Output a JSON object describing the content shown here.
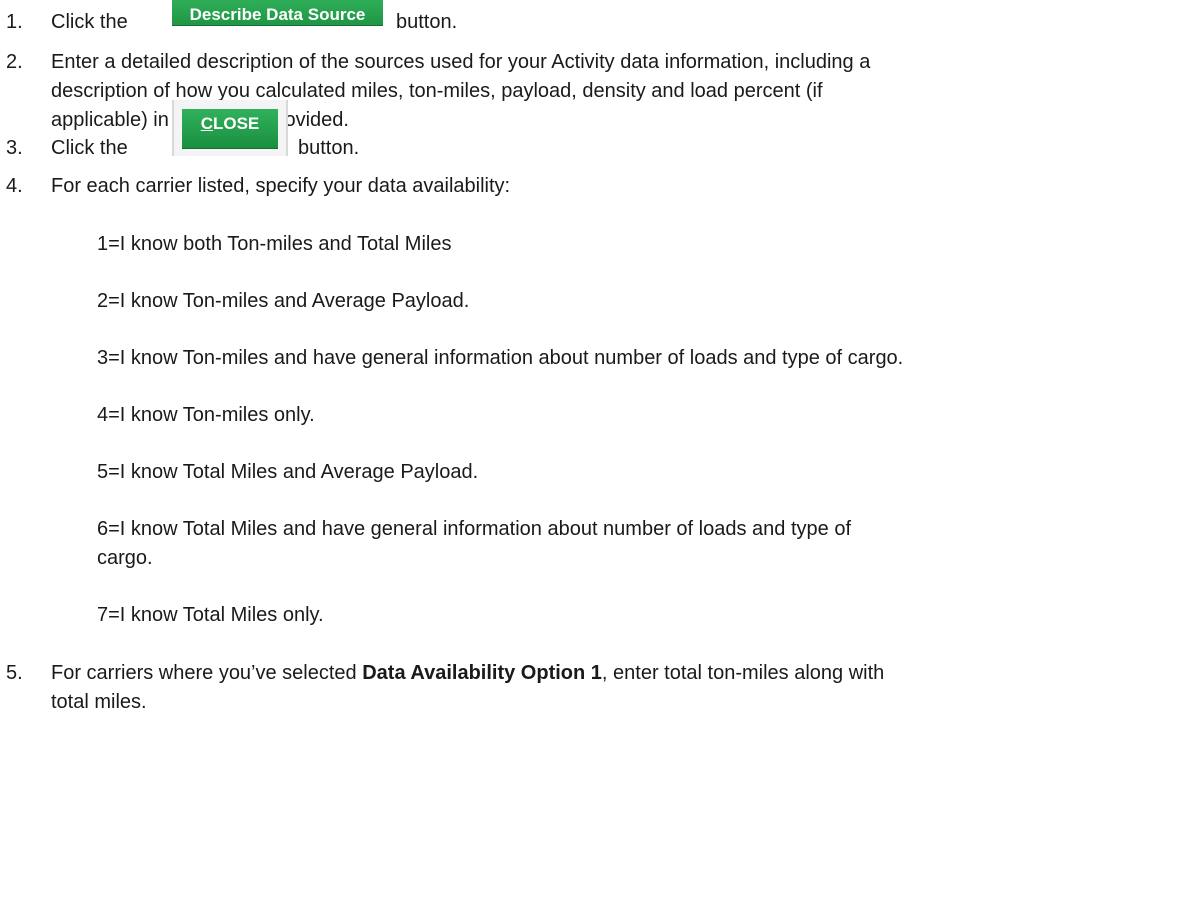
{
  "steps": [
    {
      "num": "1.",
      "prefix": "Click the",
      "button": "Describe Data Source",
      "suffix": "button."
    },
    {
      "num": "2.",
      "lines": [
        "Enter a detailed description of the sources used for your Activity data information, including a",
        "description of how you calculated miles, ton-miles, payload, density and load percent (if",
        "applicable) in the space provided."
      ]
    },
    {
      "num": "3.",
      "prefix": "Click the",
      "button_first": "C",
      "button_rest": "LOSE",
      "suffix": "button."
    },
    {
      "num": "4.",
      "text": "For each carrier listed, specify your data availability:"
    },
    {
      "num": "5.",
      "pre": "For carriers where you’ve selected ",
      "bold": "Data Availability Option 1",
      "post": ", enter total ton-miles along with",
      "line2": "total miles."
    }
  ],
  "options": [
    "1=I know both Ton-miles and Total Miles",
    "2=I know Ton-miles and Average Payload.",
    "3=I know Ton-miles and have general information about number of loads and type of cargo.",
    "4=I know Ton-miles only.",
    "5=I know Total Miles and Average Payload.",
    "6=I know Total Miles and have general information about number of loads and type of",
    "cargo.",
    "7=I know Total Miles only."
  ],
  "colors": {
    "button_green": "#2fae58",
    "text": "#1a1a1a"
  }
}
